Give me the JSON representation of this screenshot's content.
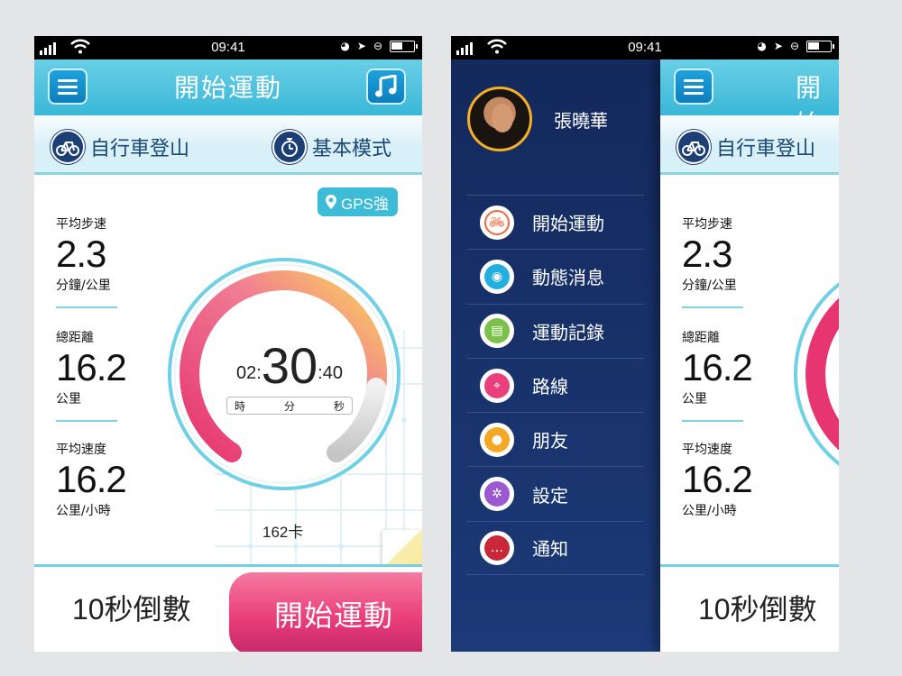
{
  "status": {
    "time": "09:41"
  },
  "app": {
    "title": "開始運動",
    "mode_left": "自行車登山",
    "mode_right": "基本模式",
    "gps_label": "GPS強",
    "stats": [
      {
        "label": "平均步速",
        "value": "2.3",
        "unit": "分鐘/公里"
      },
      {
        "label": "總距離",
        "value": "16.2",
        "unit": "公里"
      },
      {
        "label": "平均速度",
        "value": "16.2",
        "unit": "公里/小時"
      }
    ],
    "timer": {
      "hours": "02:",
      "minutes": "30",
      "seconds": ":40",
      "unit_h": "時",
      "unit_m": "分",
      "unit_s": "秒"
    },
    "calories": "162卡",
    "countdown": "10秒倒數",
    "start_button": "開始運動"
  },
  "drawer": {
    "user_name": "張曉華",
    "items": [
      {
        "label": "開始運動",
        "icon": "bicycle-icon",
        "color": "#ef6a3a"
      },
      {
        "label": "動態消息",
        "icon": "feed-icon",
        "color": "#23aee0"
      },
      {
        "label": "運動記錄",
        "icon": "document-icon",
        "color": "#7cc24a"
      },
      {
        "label": "路線",
        "icon": "map-pin-icon",
        "color": "#e9407c"
      },
      {
        "label": "朋友",
        "icon": "friends-icon",
        "color": "#f4a823"
      },
      {
        "label": "設定",
        "icon": "gear-icon",
        "color": "#9b59d0"
      },
      {
        "label": "通知",
        "icon": "message-icon",
        "color": "#c8283a"
      }
    ]
  },
  "peek": {
    "title_fragment": "開始",
    "mode_left": "自行車登山",
    "countdown": "10秒倒數"
  }
}
